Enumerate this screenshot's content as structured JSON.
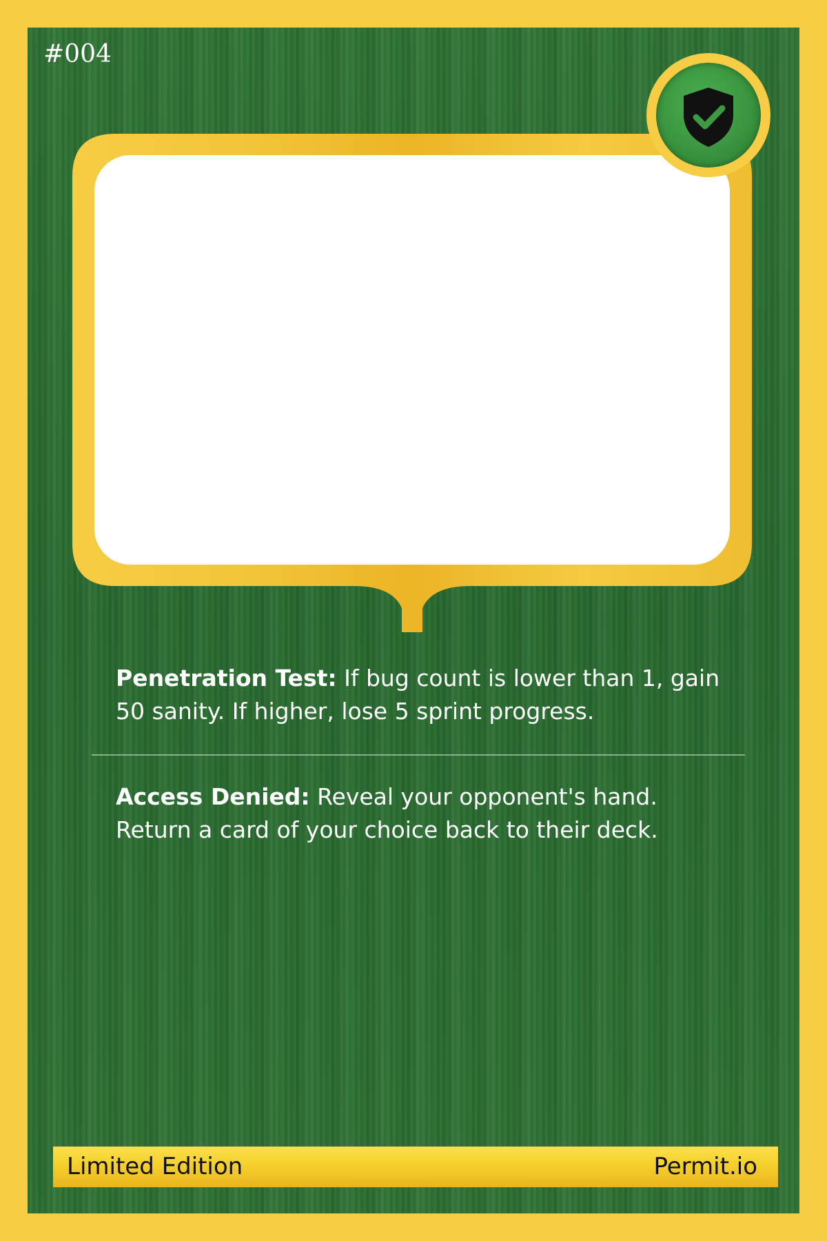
{
  "card": {
    "number": "#004",
    "badge_icon": "shield-check-icon",
    "colors": {
      "border": "#f7cd45",
      "background": "#2d7233",
      "frame_gold": "#f0bb2a",
      "badge_green": "#3d9a42",
      "text": "#ffffff"
    }
  },
  "abilities": [
    {
      "name": "Penetration Test:",
      "text": " If bug count is lower than 1, gain 50 sanity. If higher, lose 5 sprint progress."
    },
    {
      "name": "Access Denied:",
      "text": " Reveal your opponent's hand. Return a card of your choice back to their deck."
    }
  ],
  "footer": {
    "left": "Limited Edition",
    "right": "Permit.io"
  }
}
